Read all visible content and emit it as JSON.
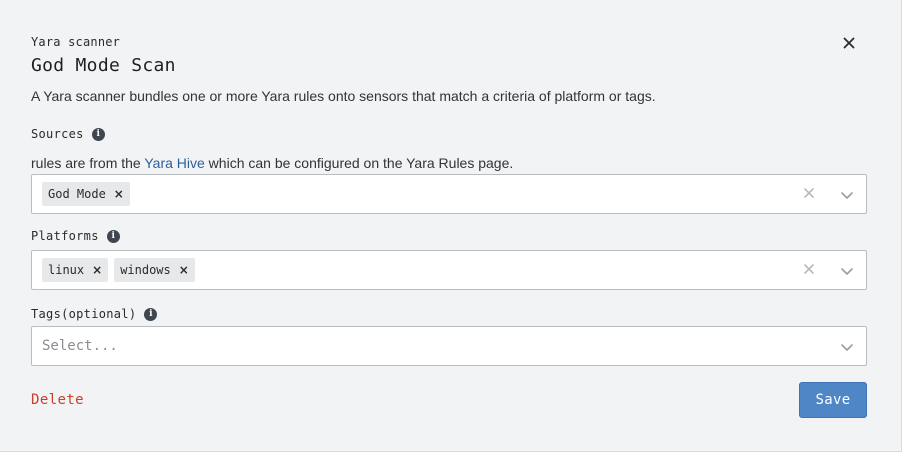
{
  "modal": {
    "kicker": "Yara scanner",
    "title": "God Mode Scan",
    "description": "A Yara scanner bundles one or more Yara rules onto sensors that match a criteria of platform or tags."
  },
  "sources": {
    "label": "Sources",
    "help_prefix": "rules are from the ",
    "help_link": "Yara Hive",
    "help_suffix": " which can be configured on the Yara Rules page.",
    "chips": [
      "God Mode"
    ]
  },
  "platforms": {
    "label": "Platforms",
    "chips": [
      "linux",
      "windows"
    ]
  },
  "tags": {
    "label": "Tags(optional)",
    "placeholder": "Select..."
  },
  "actions": {
    "delete_label": "Delete",
    "save_label": "Save"
  },
  "colors": {
    "accent": "#4f86c6",
    "danger": "#c9402b",
    "link": "#2f5f9a"
  },
  "icons": {
    "close": "close-icon",
    "info": "info-icon",
    "remove_chip": "remove-chip-icon",
    "clear": "clear-icon",
    "dropdown": "chevron-down-icon"
  }
}
